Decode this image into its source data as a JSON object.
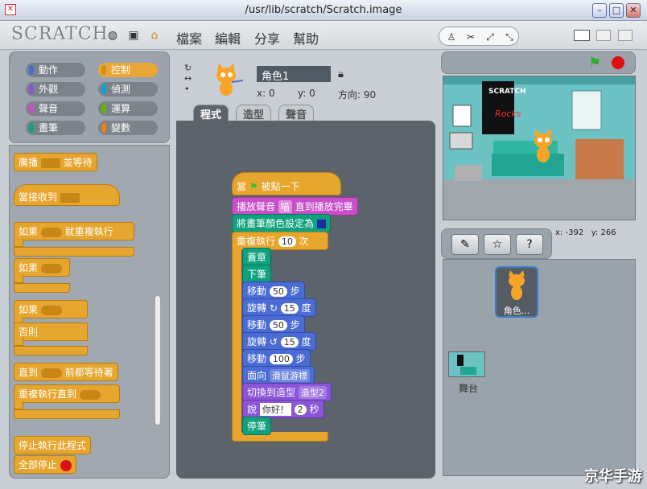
{
  "window": {
    "title": "/usr/lib/scratch/Scratch.image"
  },
  "menu": {
    "logo": "SCRATCH",
    "items": [
      "檔案",
      "編輯",
      "分享",
      "幫助"
    ]
  },
  "categories": [
    {
      "label": "動作",
      "color": "#4a6cd4"
    },
    {
      "label": "控制",
      "color": "#e6a52d"
    },
    {
      "label": "外觀",
      "color": "#8a55d7"
    },
    {
      "label": "偵測",
      "color": "#0aa3d0"
    },
    {
      "label": "聲音",
      "color": "#c94fc9"
    },
    {
      "label": "運算",
      "color": "#5cb712"
    },
    {
      "label": "畫筆",
      "color": "#10a17e"
    },
    {
      "label": "變數",
      "color": "#ee7d16"
    }
  ],
  "palette": {
    "broadcast_wait": "廣播",
    "broadcast_wait2": "並等待",
    "when_receive": "當接收到",
    "forever_if": "如果",
    "forever_if2": "就重複執行",
    "if": "如果",
    "if_else": "如果",
    "else": "否則",
    "wait_until": "直到",
    "wait_until2": "前都等待著",
    "repeat_until": "重複執行直到",
    "stop_script": "停止執行此程式",
    "stop_all": "全部停止"
  },
  "sprite": {
    "name": "角色1",
    "x_label": "x:",
    "x": "0",
    "y_label": "y:",
    "y": "0",
    "dir_label": "方向:",
    "dir": "90"
  },
  "tabs": [
    "程式",
    "造型",
    "聲音"
  ],
  "script": {
    "when_flag": "當",
    "when_flag2": "被點一下",
    "play_sound": "播放聲音",
    "sound_name": "喵",
    "play_sound2": "直到播放完畢",
    "set_pen_color": "將畫筆顏色設定為",
    "repeat": "重複執行",
    "repeat_n": "10",
    "repeat2": "次",
    "pen_down": "蓋章",
    "pen_down2": "下筆",
    "move": "移動",
    "move_n1": "50",
    "steps": "步",
    "turn": "旋轉",
    "turn_n1": "15",
    "degrees": "度",
    "move_n2": "50",
    "turn_n2": "15",
    "move_n3": "100",
    "point_towards": "面向",
    "point_target": "滑鼠游標",
    "switch_costume": "切換到造型",
    "costume_name": "造型2",
    "say": "說",
    "say_text": "你好！",
    "say_secs": "2",
    "secs": "秒",
    "pen_up": "停筆"
  },
  "stage": {
    "mouse_x_label": "x:",
    "mouse_x": "-392",
    "mouse_y_label": "y:",
    "mouse_y": "266",
    "poster_line1": "SCRATCH",
    "poster_line2": "Rocks"
  },
  "sprites_panel": {
    "sprite_label": "角色...",
    "stage_label": "舞台"
  },
  "watermark": "京华手游"
}
